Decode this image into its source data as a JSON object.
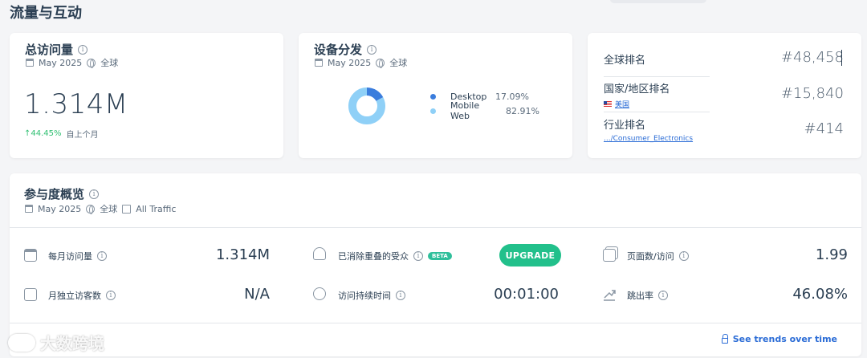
{
  "page": {
    "title": "流量与互动"
  },
  "visits": {
    "title": "总访问量",
    "date": "May 2025",
    "region": "全球",
    "value": "1.314M",
    "change": "44.45%",
    "change_label": "自上个月"
  },
  "devices": {
    "title": "设备分发",
    "date": "May 2025",
    "region": "全球",
    "items": [
      {
        "name": "Desktop",
        "value": "17.09%",
        "share": 17.09,
        "color": "#3b7ddd"
      },
      {
        "name": "Mobile Web",
        "value": "82.91%",
        "share": 82.91,
        "color": "#8fd0f7"
      }
    ]
  },
  "ranks": {
    "global": {
      "label": "全球排名",
      "value": "#48,458"
    },
    "country": {
      "label": "国家/地区排名",
      "sub": "美国",
      "value": "#15,840"
    },
    "industry": {
      "label": "行业排名",
      "sub": ".../Consumer_Electronics",
      "value": "#414"
    }
  },
  "engagement": {
    "title": "参与度概览",
    "date": "May 2025",
    "region": "全球",
    "traffic": "All Traffic",
    "metrics": {
      "monthly_visits": {
        "label": "每月访问量",
        "value": "1.314M"
      },
      "unique_visitors": {
        "label": "月独立访客数",
        "value": "N/A"
      },
      "dedup_audience": {
        "label": "已消除重叠的受众",
        "badge": "BETA",
        "button": "UPGRADE"
      },
      "visit_duration": {
        "label": "访问持续时间",
        "value": "00:01:00"
      },
      "pages_per_visit": {
        "label": "页面数/访问",
        "value": "1.99"
      },
      "bounce_rate": {
        "label": "跳出率",
        "value": "46.08%"
      }
    },
    "trends_link": "See trends over time"
  },
  "watermark": {
    "text": "大数跨境"
  }
}
